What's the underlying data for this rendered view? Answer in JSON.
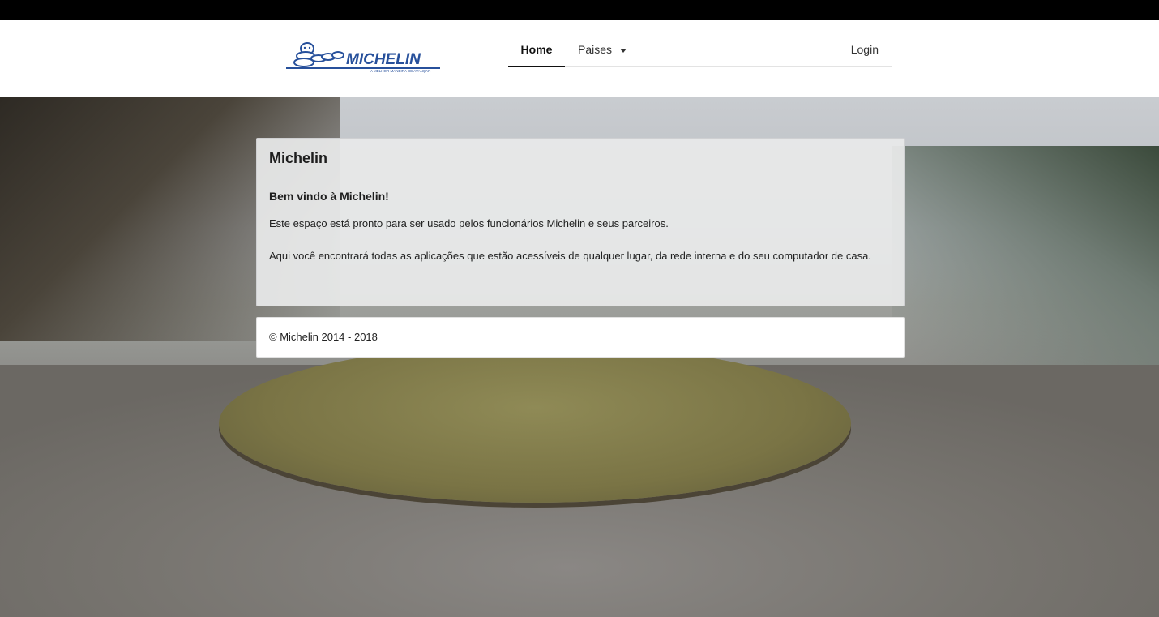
{
  "header": {
    "logo_text": "MICHELIN",
    "logo_tagline": "A MELHOR MANEIRA DE AVANÇAR",
    "brand_color": "#27509b",
    "nav": {
      "home": "Home",
      "paises": "Paises",
      "login": "Login"
    }
  },
  "card": {
    "title": "Michelin",
    "subtitle": "Bem vindo à Michelin!",
    "paragraph1": "Este espaço está pronto para ser usado pelos funcionários Michelin e seus parceiros.",
    "paragraph2": "Aqui você encontrará todas as aplicações que estão acessíveis de qualquer lugar, da rede interna e do seu computador de casa."
  },
  "footer": {
    "text": "© Michelin 2014 - 2018"
  }
}
